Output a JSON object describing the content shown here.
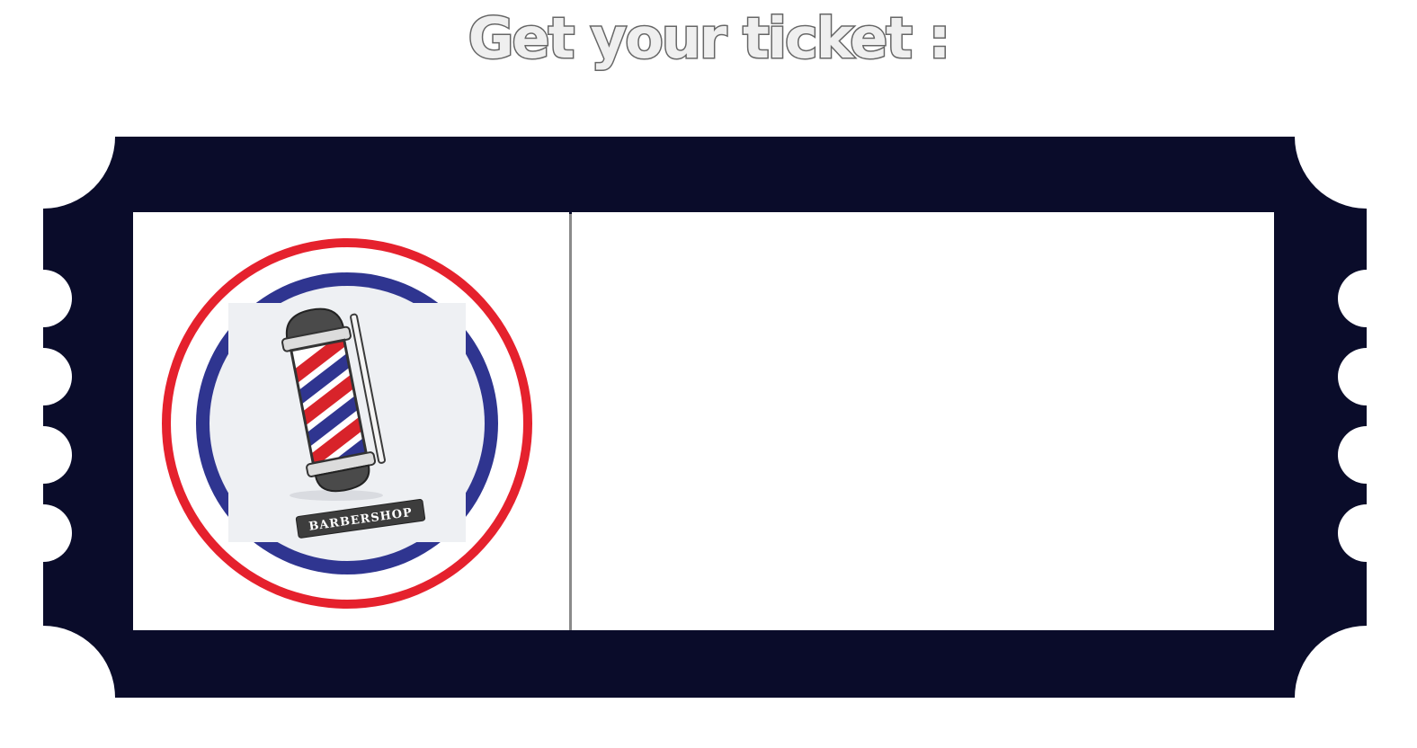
{
  "page": {
    "title": "Get your ticket :"
  },
  "ticket": {
    "frame_color": "#0a0c2a",
    "panel_color": "#ffffff",
    "divider_color": "#8a8a8a",
    "logo": {
      "text": "BARBERSHOP",
      "ring_outer_color": "#e5212d",
      "ring_inner_color": "#2f3590",
      "stripe_colors": [
        "#d8232a",
        "#ffffff",
        "#2f3590"
      ],
      "icon": "barber-pole-icon"
    }
  }
}
